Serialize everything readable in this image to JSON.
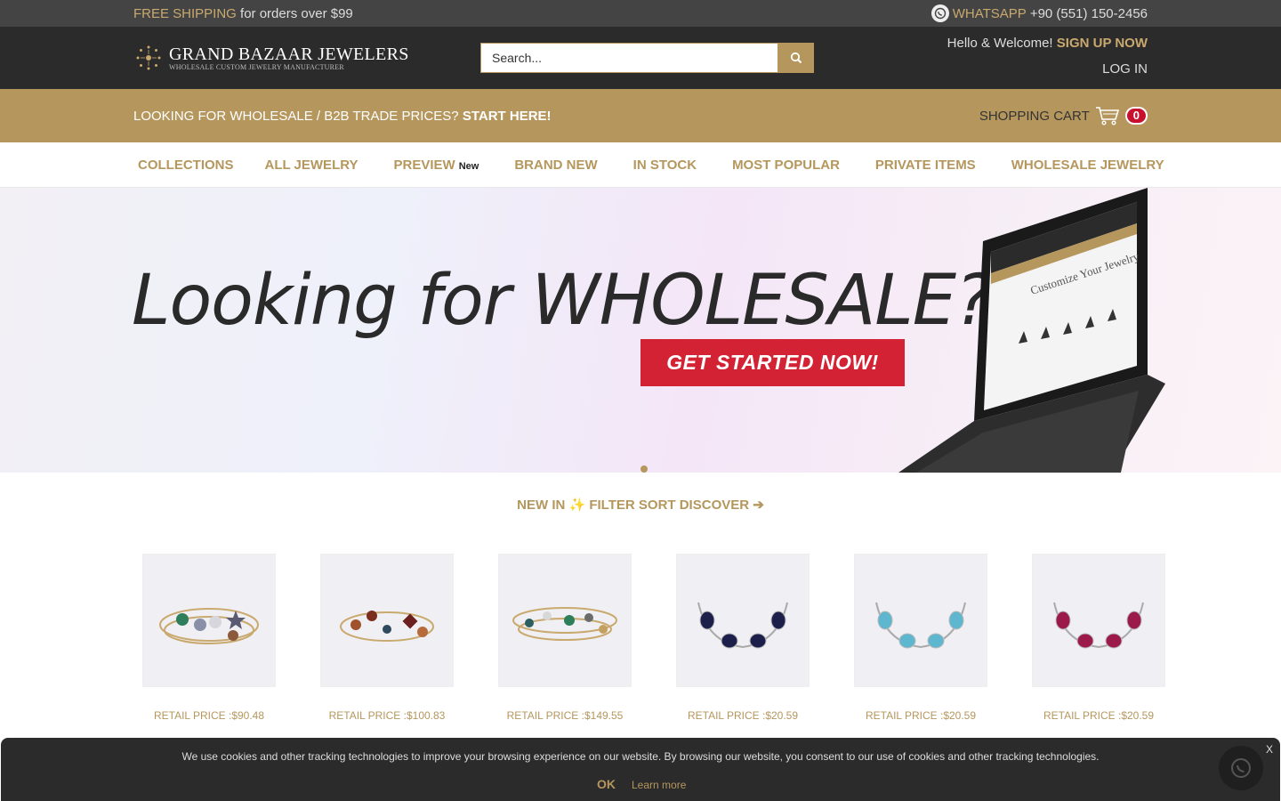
{
  "topbar": {
    "shipping_highlight": "FREE SHIPPING",
    "shipping_rest": "for orders over $99",
    "whatsapp_label": "WHATSAPP",
    "whatsapp_number": "+90 (551) 150-2456"
  },
  "header": {
    "logo_name": "GRAND BAZAAR JEWELERS",
    "logo_tagline": "WHOLESALE CUSTOM JEWELRY MANUFACTURER",
    "search_placeholder": "Search...",
    "hello": "Hello & Welcome!",
    "signup": "SIGN UP NOW",
    "login": "LOG IN"
  },
  "goldbar": {
    "question": "LOOKING FOR WHOLESALE / B2B TRADE PRICES?",
    "start": "START HERE!",
    "cart_label": "SHOPPING CART",
    "cart_count": "0"
  },
  "nav": {
    "items": [
      "COLLECTIONS",
      "ALL JEWELRY",
      "PREVIEW",
      "BRAND NEW",
      "IN STOCK",
      "MOST POPULAR",
      "PRIVATE ITEMS",
      "WHOLESALE JEWELRY"
    ],
    "preview_badge": "New"
  },
  "hero": {
    "headline": "Looking for WHOLESALE?",
    "cta": "GET STARTED NOW!"
  },
  "section": {
    "newin": "NEW IN ✨ FILTER SORT DISCOVER ➔"
  },
  "products": [
    {
      "price": "RETAIL PRICE :$90.48",
      "stones": [
        "#2e7d5b",
        "#8a8fa8",
        "#d6d6dc",
        "#5a5a72",
        "#8b5a3c"
      ]
    },
    {
      "price": "RETAIL PRICE :$100.83",
      "stones": [
        "#a0522d",
        "#7b2d1e",
        "#2e4a5c",
        "#6b1f1f",
        "#b86b3a"
      ]
    },
    {
      "price": "RETAIL PRICE :$149.55",
      "stones": [
        "#2b5f5f",
        "#d8d8d8",
        "#2e7d5b",
        "#6b6b6b",
        "#c4a060"
      ]
    },
    {
      "price": "RETAIL PRICE :$20.59",
      "stones": [
        "#1b1f4a",
        "#1b1f4a",
        "#1b1f4a",
        "#1b1f4a"
      ]
    },
    {
      "price": "RETAIL PRICE :$20.59",
      "stones": [
        "#5fb6cf",
        "#5fb6cf",
        "#5fb6cf",
        "#5fb6cf"
      ]
    },
    {
      "price": "RETAIL PRICE :$20.59",
      "stones": [
        "#9b1a4a",
        "#9b1a4a",
        "#9b1a4a",
        "#9b1a4a"
      ]
    }
  ],
  "cookie": {
    "message": "We use cookies and other tracking technologies to improve your browsing experience on our website. By browsing our website, you consent to our use of cookies and other tracking technologies.",
    "ok": "OK",
    "learn_more": "Learn more",
    "close": "X"
  },
  "colors": {
    "gold": "#b5975e",
    "dark": "#2b2b2b",
    "cta_red": "#d32234"
  }
}
